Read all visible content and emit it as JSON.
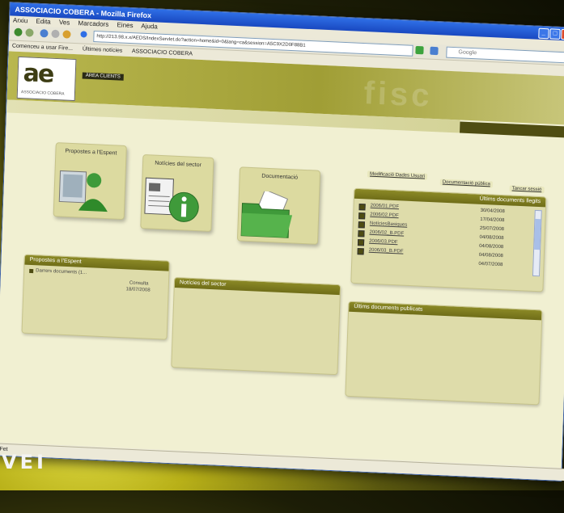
{
  "browser": {
    "title": "ASSOCIACIO COBERA - Mozilla Firefox",
    "menu": [
      "Arxiu",
      "Edita",
      "Ves",
      "Marcadors",
      "Eines",
      "Ajuda"
    ],
    "url": "http://213.98.x.x/AEDS/IndexServlet.do?action=home&id=0&lang=ca&session=A5C9X2D0F88B1",
    "search_placeholder": "Google",
    "bookmarks": [
      "Comenceu a usar Fire...",
      "Últimes notícies",
      "ASSOCIACIO COBERA"
    ],
    "status": "Fet"
  },
  "site": {
    "logo_mark": "ae",
    "logo_sub": "ASSOCIACIO COBERA",
    "access_button": "ÀREA CLIENTS",
    "watermark": "fisc"
  },
  "tiles": {
    "propostes": "Propostes a l'Espent",
    "noticies": "Notícies del sector",
    "documentacio": "Documentació"
  },
  "toplinks": {
    "one": "Modificació Dades Usuari",
    "two": "Documentació pública",
    "three": "Tancar sessió"
  },
  "docs_panel": {
    "title": "Últims documents llegits",
    "rows": [
      {
        "name": "2006/01.PDF",
        "date": "30/04/2008"
      },
      {
        "name": "2006/02.PDF",
        "date": "17/04/2008"
      },
      {
        "name": "NotíciesBasiques",
        "date": "25/07/2008"
      },
      {
        "name": "2006/02_B.PDF",
        "date": "04/08/2008"
      },
      {
        "name": "2006/03.PDF",
        "date": "04/08/2008"
      },
      {
        "name": "2006/03_B.PDF",
        "date": "04/08/2008"
      },
      {
        "name": "",
        "date": "04/07/2008"
      }
    ]
  },
  "bottom_panels": {
    "propostes": {
      "title": "Propostes a l'Espent",
      "item": "Darrers documents (1...",
      "meta1": "Consulta",
      "meta2": "18/07/2008"
    },
    "noticies": {
      "title": "Notícies del sector"
    },
    "publicats": {
      "title": "Últims documents publicats"
    }
  },
  "caption": "VEI",
  "colors": {
    "accent": "#8b8926",
    "header": "#a09e35",
    "background": "#f1f0d2"
  }
}
